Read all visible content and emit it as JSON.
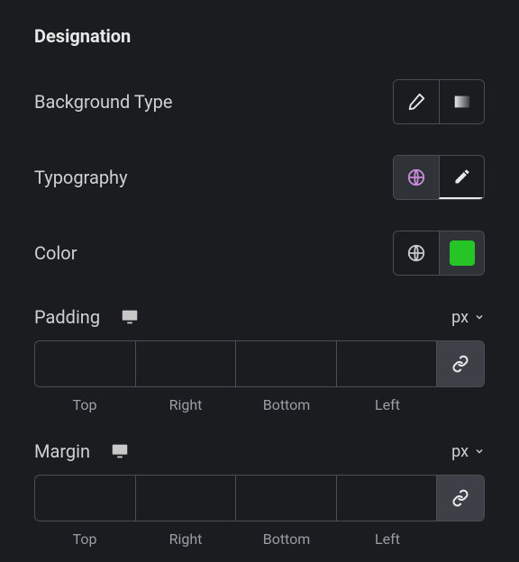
{
  "section": {
    "title": "Designation"
  },
  "backgroundType": {
    "label": "Background Type"
  },
  "typography": {
    "label": "Typography",
    "globeColor": "#c98adb"
  },
  "color": {
    "label": "Color",
    "swatch": "#26c426"
  },
  "padding": {
    "label": "Padding",
    "unit": "px",
    "sides": {
      "top": "Top",
      "right": "Right",
      "bottom": "Bottom",
      "left": "Left"
    },
    "values": {
      "top": "",
      "right": "",
      "bottom": "",
      "left": ""
    }
  },
  "margin": {
    "label": "Margin",
    "unit": "px",
    "sides": {
      "top": "Top",
      "right": "Right",
      "bottom": "Bottom",
      "left": "Left"
    },
    "values": {
      "top": "",
      "right": "",
      "bottom": "",
      "left": ""
    }
  }
}
